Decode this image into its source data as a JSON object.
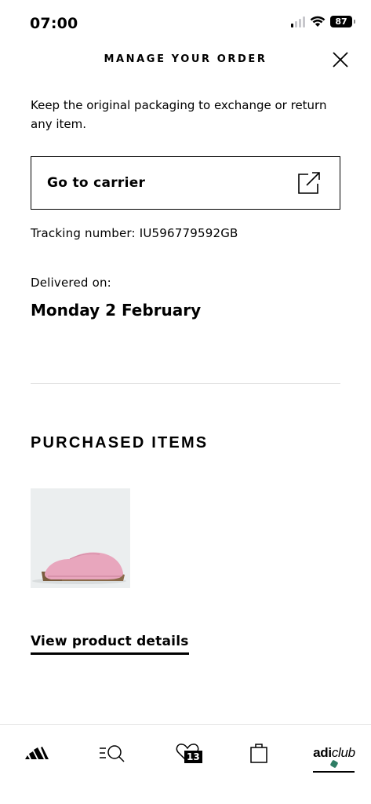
{
  "status_bar": {
    "time": "07:00",
    "battery": "87"
  },
  "header": {
    "title": "MANAGE YOUR ORDER"
  },
  "intro": {
    "text": "Keep the original packaging to exchange or return any item."
  },
  "carrier": {
    "label": "Go to carrier"
  },
  "tracking": {
    "text": "Tracking number: IU596779592GB"
  },
  "delivery": {
    "label": "Delivered on:",
    "date": "Monday 2 February"
  },
  "purchased": {
    "heading": "PURCHASED ITEMS"
  },
  "product": {
    "link_label": "View product details"
  },
  "nav": {
    "wishlist_count": "13",
    "adiclub_bold": "adi",
    "adiclub_italic": "club"
  },
  "colors": {
    "accent_green": "#2e7d64",
    "product_bg": "#ebeeef",
    "slipper_pink": "#e8a6bd"
  }
}
